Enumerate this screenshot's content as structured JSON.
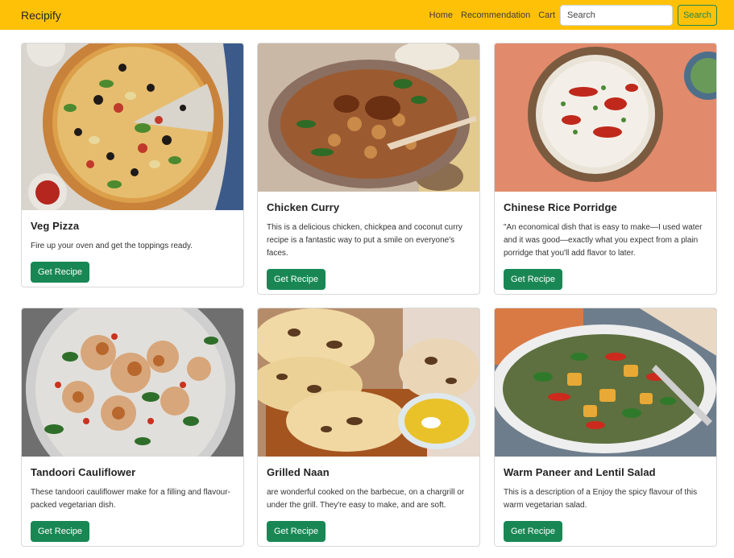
{
  "navbar": {
    "brand": "Recipify",
    "links": [
      "Home",
      "Recommendation",
      "Cart"
    ],
    "search_placeholder": "Search",
    "search_button": "Search"
  },
  "cards": [
    {
      "title": "Veg Pizza",
      "text": "Fire up your oven and get the toppings ready.",
      "button": "Get Recipe"
    },
    {
      "title": "Chicken Curry",
      "text": "This is a delicious chicken, chickpea and coconut curry recipe is a fantastic way to put a smile on everyone's faces.",
      "button": "Get Recipe"
    },
    {
      "title": "Chinese Rice Porridge",
      "text": "\"An economical dish that is easy to make—I used water and it was good—exactly what you expect from a plain porridge that you'll add flavor to later.",
      "button": "Get Recipe"
    },
    {
      "title": "Tandoori Cauliflower",
      "text": "These tandoori cauliflower make for a filling and flavour-packed vegetarian dish.",
      "button": "Get Recipe"
    },
    {
      "title": "Grilled Naan",
      "text": "are wonderful cooked on the barbecue, on a chargrill or under the grill. They're easy to make, and are soft.",
      "button": "Get Recipe"
    },
    {
      "title": "Warm Paneer and Lentil Salad",
      "text": "This is a description of a Enjoy the spicy flavour of this warm vegetarian salad.",
      "button": "Get Recipe"
    }
  ],
  "colors": {
    "navbar": "#ffc107",
    "success": "#198754"
  }
}
